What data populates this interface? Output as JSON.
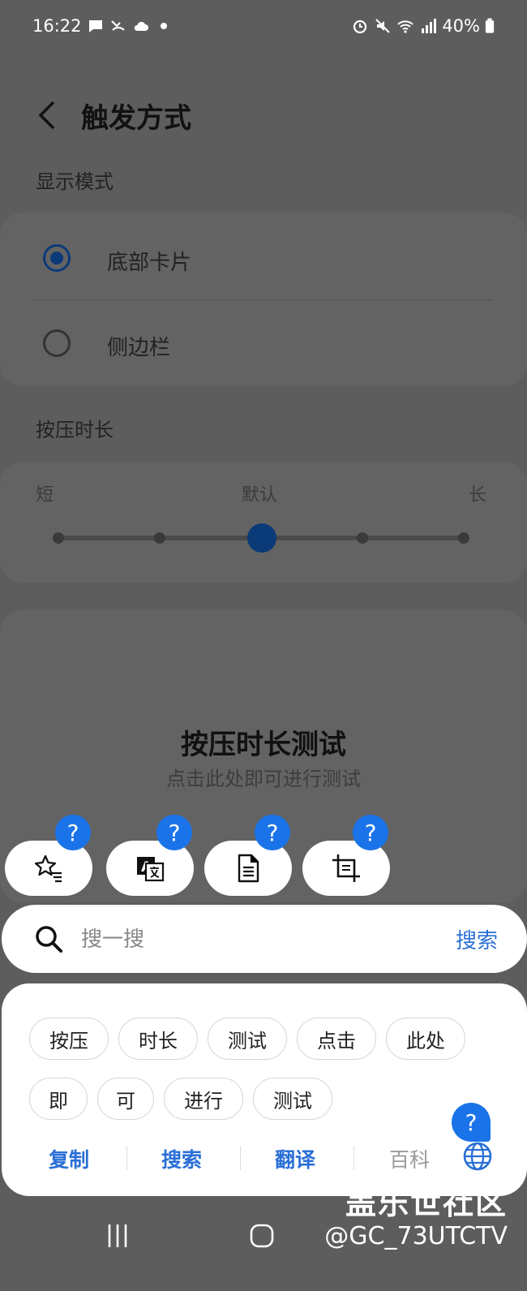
{
  "status_bar": {
    "time": "16:22",
    "battery": "40%"
  },
  "header": {
    "title": "触发方式"
  },
  "display_mode": {
    "label": "显示模式",
    "options": [
      {
        "label": "底部卡片",
        "selected": true
      },
      {
        "label": "侧边栏",
        "selected": false
      }
    ]
  },
  "press_duration": {
    "label": "按压时长",
    "min_label": "短",
    "mid_label": "默认",
    "max_label": "长",
    "steps": 5,
    "selected_step": 3
  },
  "test_area": {
    "title": "按压时长测试",
    "subtitle": "点击此处即可进行测试"
  },
  "toolbar": {
    "icons": [
      "star-list-icon",
      "translate-icon",
      "document-icon",
      "crop-icon"
    ],
    "badge": "?"
  },
  "search": {
    "placeholder": "搜一搜",
    "button": "搜索"
  },
  "chips": [
    "按压",
    "时长",
    "测试",
    "点击",
    "此处",
    "即",
    "可",
    "进行",
    "测试"
  ],
  "actions": {
    "copy": "复制",
    "search": "搜索",
    "translate": "翻译",
    "wiki": "百科"
  },
  "help_badge": "?",
  "watermark": {
    "line1": "盖乐世社区",
    "line2": "@GC_73UTCTV"
  },
  "colors": {
    "accent": "#2a6fd6",
    "selected": "#0b3a78",
    "badge": "#1a73e8",
    "scrim": "#5d5d5d"
  }
}
